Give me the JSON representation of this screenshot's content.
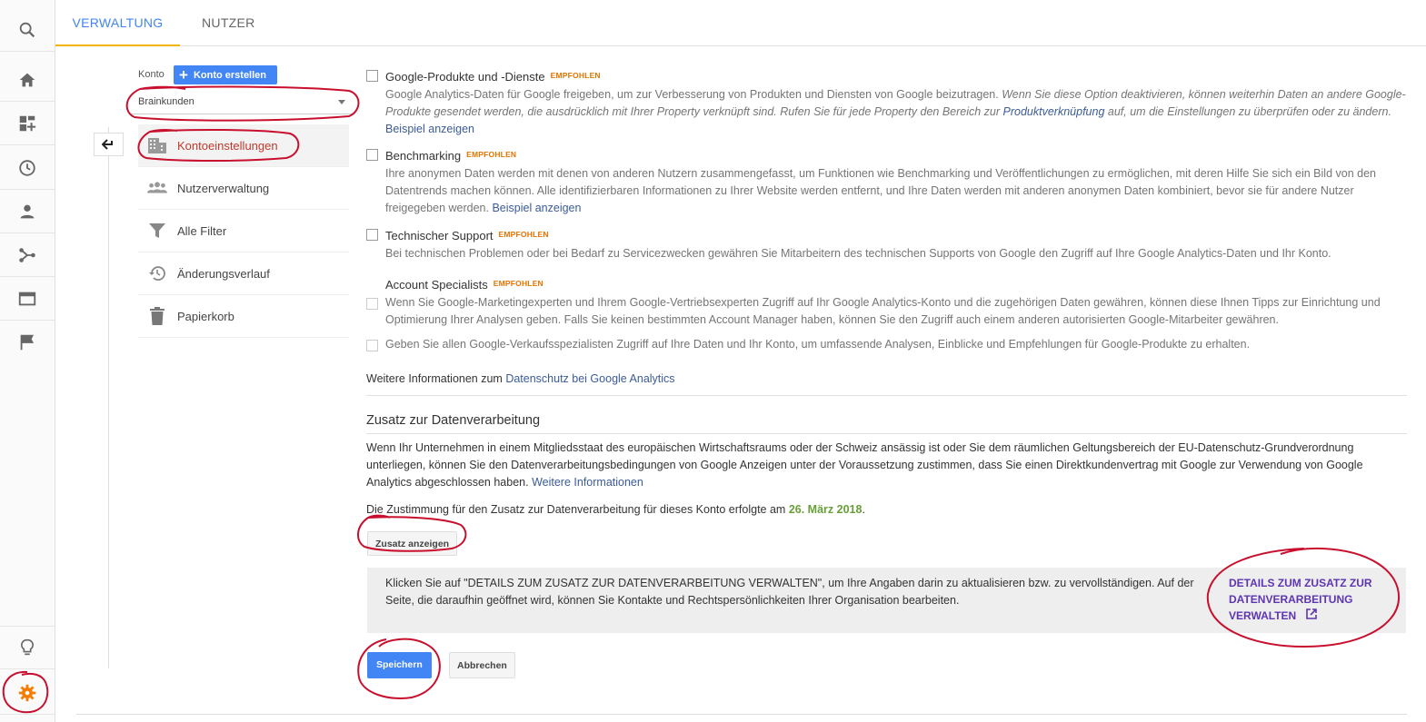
{
  "tabs": [
    "VERWALTUNG",
    "NUTZER"
  ],
  "rail": {
    "icons": [
      "search-icon",
      "home-icon",
      "dashboard-icon",
      "clock-icon",
      "person-icon",
      "share-icon",
      "display-icon",
      "flag-icon",
      "lightbulb-icon",
      "gear-icon"
    ],
    "active_color": "#f57c00"
  },
  "account": {
    "label": "Konto",
    "create_button": "Konto erstellen",
    "selected": "Brainkunden"
  },
  "menu": [
    {
      "label": "Kontoeinstellungen",
      "icon": "building-icon",
      "active": true
    },
    {
      "label": "Nutzerverwaltung",
      "icon": "people-icon",
      "active": false
    },
    {
      "label": "Alle Filter",
      "icon": "filter-icon",
      "active": false
    },
    {
      "label": "Änderungsverlauf",
      "icon": "history-icon",
      "active": false
    },
    {
      "label": "Papierkorb",
      "icon": "trash-icon",
      "active": false
    }
  ],
  "options": {
    "badge": "EMPFOHLEN",
    "google_products": {
      "title": "Google-Produkte und -Dienste",
      "desc_a": "Google Analytics-Daten für Google freigeben, um zur Verbesserung von Produkten und Diensten von Google beizutragen.",
      "desc_b": "Wenn Sie diese Option deaktivieren, können weiterhin Daten an andere Google-Produkte gesendet werden, die ausdrücklich mit Ihrer Property verknüpft sind. Rufen Sie für jede Property den Bereich zur",
      "desc_link": "Produktverknüpfung",
      "desc_c": "auf, um die Einstellungen zu überprüfen oder zu ändern.",
      "example": "Beispiel anzeigen"
    },
    "benchmarking": {
      "title": "Benchmarking",
      "desc": "Ihre anonymen Daten werden mit denen von anderen Nutzern zusammengefasst, um Funktionen wie Benchmarking und Veröffentlichungen zu ermöglichen, mit deren Hilfe Sie sich ein Bild von den Datentrends machen können. Alle identifizierbaren Informationen zu Ihrer Website werden entfernt, und Ihre Daten werden mit anderen anonymen Daten kombiniert, bevor sie für andere Nutzer freigegeben werden.",
      "example": "Beispiel anzeigen"
    },
    "tech_support": {
      "title": "Technischer Support",
      "desc": "Bei technischen Problemen oder bei Bedarf zu Servicezwecken gewähren Sie Mitarbeitern des technischen Supports von Google den Zugriff auf Ihre Google Analytics-Daten und Ihr Konto."
    },
    "specialists": {
      "title": "Account Specialists",
      "opt1": "Wenn Sie Google-Marketingexperten und Ihrem Google-Vertriebsexperten Zugriff auf Ihr Google Analytics-Konto und die zugehörigen Daten gewähren, können diese Ihnen Tipps zur Einrichtung und Optimierung Ihrer Analysen geben. Falls Sie keinen bestimmten Account Manager haben, können Sie den Zugriff auch einem anderen autorisierten Google-Mitarbeiter gewähren.",
      "opt2": "Geben Sie allen Google-Verkaufsspezialisten Zugriff auf Ihre Daten und Ihr Konto, um umfassende Analysen, Einblicke und Empfehlungen für Google-Produkte zu erhalten."
    }
  },
  "privacy": {
    "text": "Weitere Informationen zum",
    "link": "Datenschutz bei Google Analytics"
  },
  "dpa": {
    "heading": "Zusatz zur Datenverarbeitung",
    "body": "Wenn Ihr Unternehmen in einem Mitgliedsstaat des europäischen Wirtschaftsraums oder der Schweiz ansässig ist oder Sie dem räumlichen Geltungsbereich der EU-Datenschutz-Grundverordnung unterliegen, können Sie den Datenverarbeitungsbedingungen von Google Anzeigen unter der Voraussetzung zustimmen, dass Sie einen Direktkundenvertrag mit Google zur Verwendung von Google Analytics abgeschlossen haben.",
    "more_link": "Weitere Informationen",
    "consent_text": "Die Zustimmung für den Zusatz zur Datenverarbeitung für dieses Konto erfolgte am",
    "consent_date": "26. März 2018",
    "show_button": "Zusatz anzeigen",
    "info_text": "Klicken Sie auf \"DETAILS ZUM ZUSATZ ZUR DATENVERARBEITUNG VERWALTEN\", um Ihre Angaben darin zu aktualisieren bzw. zu vervollständigen. Auf der Seite, die daraufhin geöffnet wird, können Sie Kontakte und Rechtspersönlichkeiten Ihrer Organisation bearbeiten.",
    "manage_link_line1": "DETAILS ZUM ZUSATZ ZUR",
    "manage_link_line2": "DATENVERARBEITUNG",
    "manage_link_line3": "VERWALTEN"
  },
  "footer_buttons": {
    "save": "Speichern",
    "cancel": "Abbrechen"
  },
  "colors": {
    "brand_blue": "#4285f4",
    "badge_orange": "#e37400",
    "annotation_red": "#c8102e",
    "link_purple": "#5e35b1",
    "date_green": "#689f38"
  }
}
